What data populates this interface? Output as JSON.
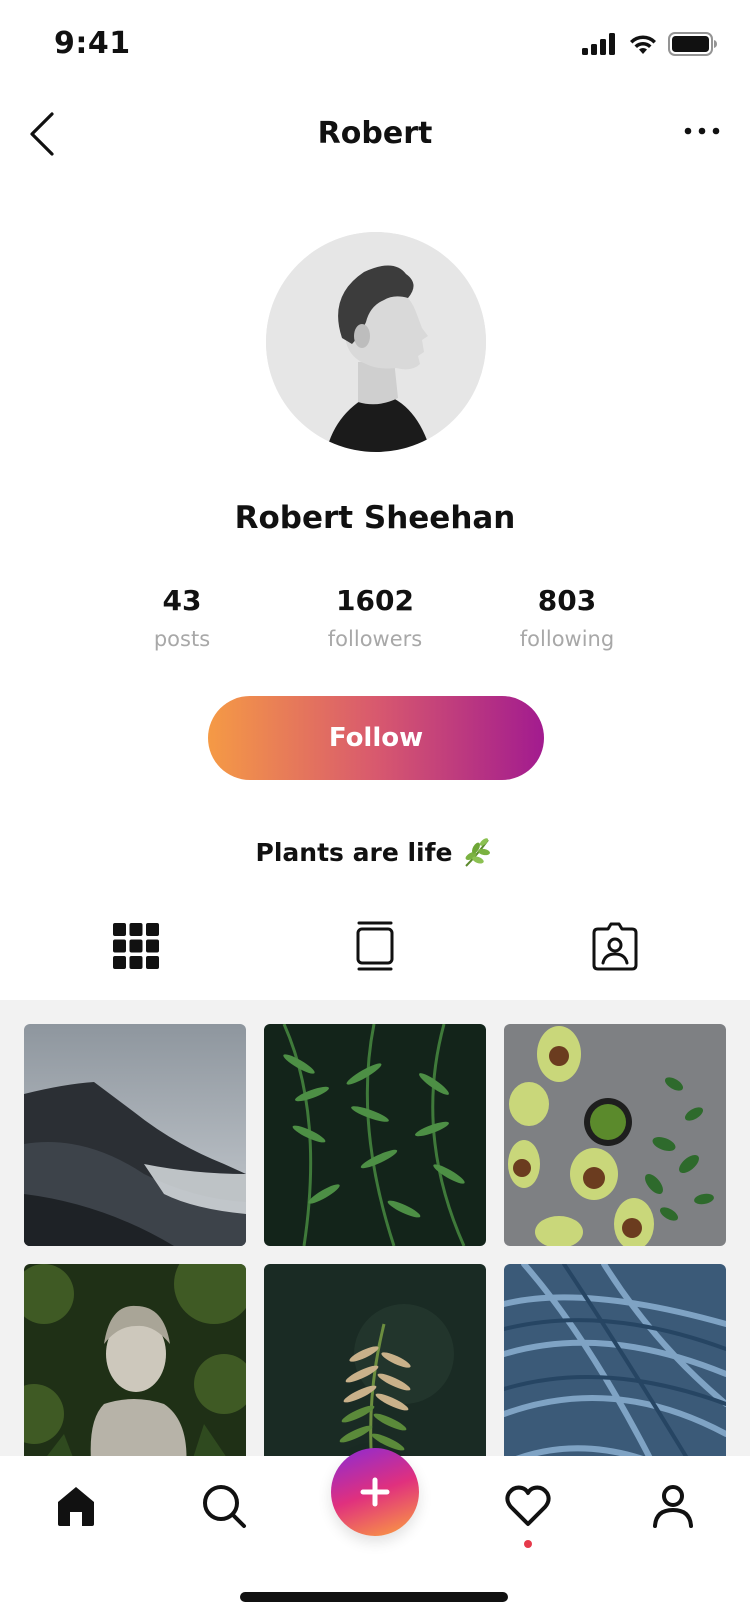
{
  "status_bar": {
    "time": "9:41"
  },
  "nav": {
    "title": "Robert"
  },
  "profile": {
    "name": "Robert Sheehan",
    "bio": "Plants are life",
    "stats": [
      {
        "value": "43",
        "label": "posts"
      },
      {
        "value": "1602",
        "label": "followers"
      },
      {
        "value": "803",
        "label": "following"
      }
    ],
    "follow_label": "Follow"
  },
  "tabs": [
    {
      "icon": "grid-icon"
    },
    {
      "icon": "post-stack-icon"
    },
    {
      "icon": "tagged-portrait-icon"
    }
  ],
  "photos": [
    {
      "subject": "misty mountain coastline"
    },
    {
      "subject": "green fern leaves"
    },
    {
      "subject": "avocados and herbs"
    },
    {
      "subject": "stone statue in greenery"
    },
    {
      "subject": "fern held before face"
    },
    {
      "subject": "blue grass blades"
    }
  ],
  "bottom_tabs": [
    {
      "icon": "home-icon"
    },
    {
      "icon": "search-icon"
    },
    {
      "icon": "plus-icon"
    },
    {
      "icon": "heart-icon"
    },
    {
      "icon": "profile-icon"
    }
  ],
  "colors": {
    "follow_gradient_start": "#f59a45",
    "follow_gradient_end": "#a21b8f",
    "stat_label": "#a8a8a8",
    "notification_dot": "#e63a4b",
    "grid_background": "#f2f2f2"
  }
}
